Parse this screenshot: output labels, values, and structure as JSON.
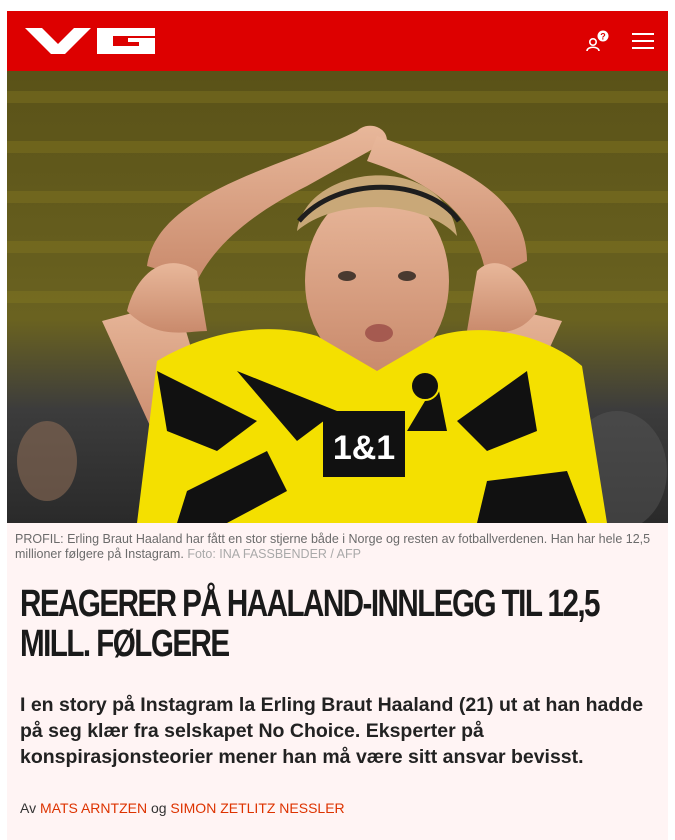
{
  "header": {
    "logo_alt": "VG",
    "brand_color": "#dd0000",
    "profile_icon": "user-icon",
    "menu_icon": "hamburger-menu-icon"
  },
  "hero": {
    "shirt_sponsor": "1&1"
  },
  "caption": {
    "text": "PROFIL: Erling Braut Haaland har fått en stor stjerne både i Norge og resten av fotballverdenen. Han har hele 12,5 millioner følgere på Instagram.",
    "credit": "Foto: INA FASSBENDER / AFP"
  },
  "article": {
    "headline": "REAGERER PÅ HAALAND-INNLEGG TIL 12,5 MILL. FØLGERE",
    "lead": "I en story på Instagram la Erling Braut Haaland (21) ut at han hadde på seg klær fra selskapet No Choice. Eksperter på konspirasjonsteorier mener han må være sitt ansvar bevisst.",
    "byline_prefix": "Av",
    "byline_joiner": "og",
    "authors": [
      "MATS ARNTZEN",
      "SIMON ZETLITZ NESSLER"
    ]
  }
}
